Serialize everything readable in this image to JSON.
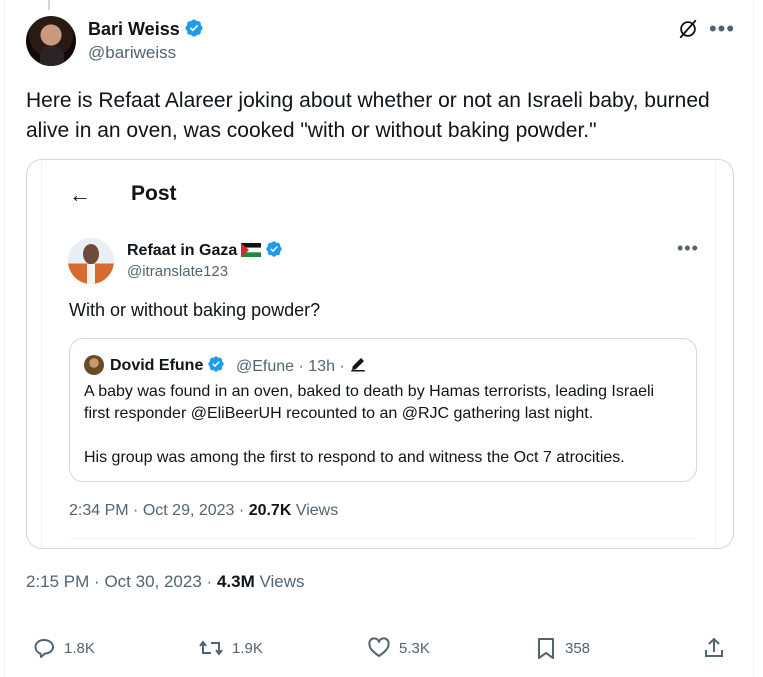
{
  "author": {
    "name": "Bari Weiss",
    "handle": "@bariweiss"
  },
  "tweet": {
    "text": "Here is Refaat Alareer joking about whether or not an Israeli baby, burned alive in an oven, was cooked \"with or without baking powder.\"",
    "time": "2:15 PM",
    "date": "Oct 30, 2023",
    "views_count": "4.3M",
    "views_label": "Views",
    "separator": "·"
  },
  "embedded_post": {
    "header_title": "Post",
    "author": {
      "name": "Refaat in Gaza",
      "handle": "@itranslate123"
    },
    "text": "With or without baking powder?",
    "time": "2:34 PM",
    "date": "Oct 29, 2023",
    "views_count": "20.7K",
    "views_label": "Views",
    "quoted": {
      "name": "Dovid Efune",
      "meta": "@Efune · 13h ·",
      "text1": "A baby was found in an oven, baked to death by Hamas terrorists, leading Israeli first responder @EliBeerUH recounted to an @RJC gathering last night.",
      "text2": "His group was among the first to respond to and witness the Oct 7 atrocities."
    }
  },
  "actions": {
    "replies": "1.8K",
    "reposts": "1.9K",
    "likes": "5.3K",
    "bookmarks": "358"
  },
  "icons": [
    "grok-icon",
    "more-icon",
    "verified-badge-icon",
    "back-arrow-icon",
    "palestine-flag-icon",
    "edit-pencil-icon",
    "reply-icon",
    "repost-icon",
    "like-icon",
    "bookmark-icon",
    "share-icon"
  ],
  "colors": {
    "verified_blue": "#1d9bf0",
    "text_primary": "#0f1419",
    "text_secondary": "#536471",
    "border": "#cfd9de"
  }
}
